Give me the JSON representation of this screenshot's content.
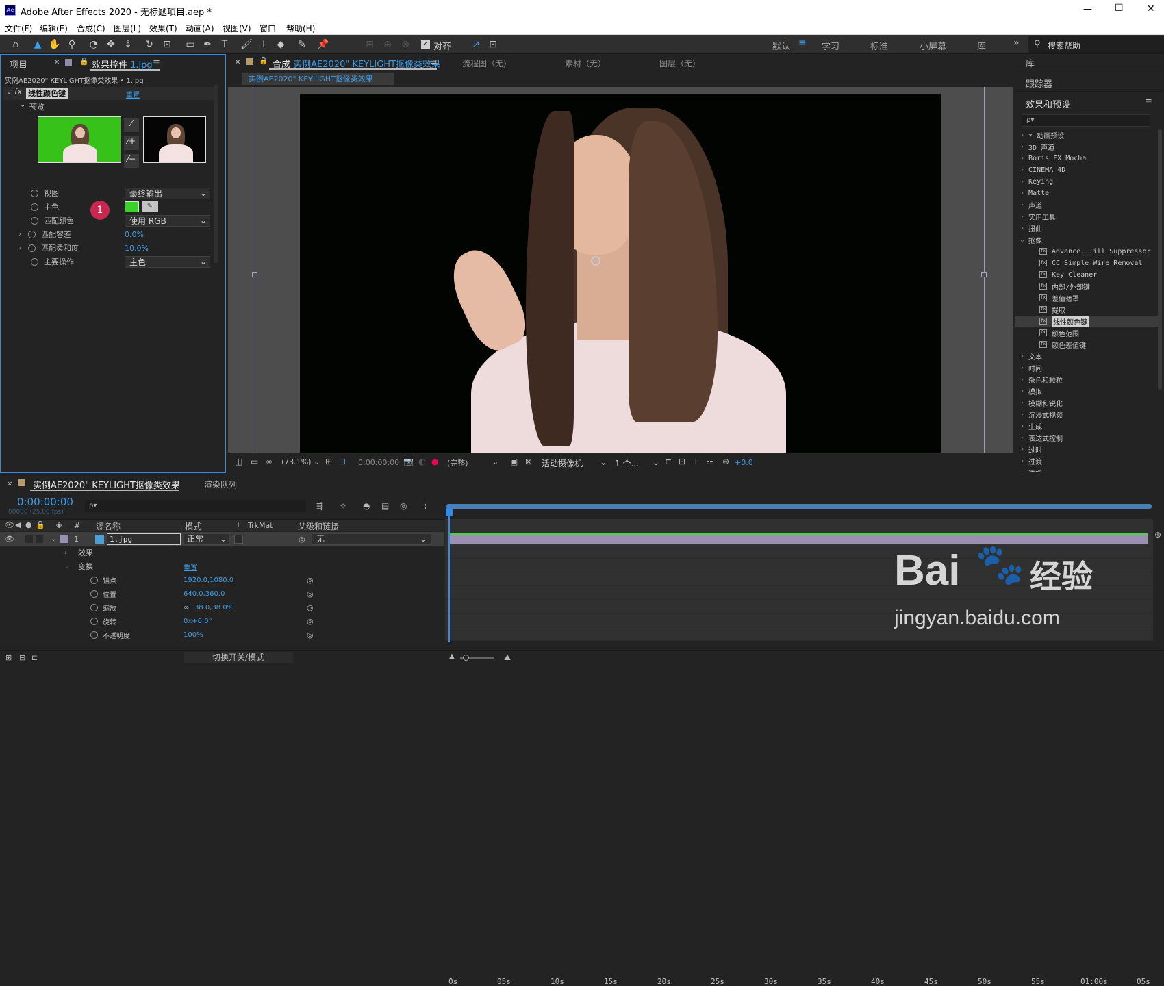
{
  "app": {
    "logo": "Ae",
    "title": "Adobe After Effects 2020 - 无标题项目.aep *"
  },
  "window_controls": {
    "minimize": "—",
    "maximize": "☐",
    "close": "✕"
  },
  "menu": [
    "文件(F)",
    "编辑(E)",
    "合成(C)",
    "图层(L)",
    "效果(T)",
    "动画(A)",
    "视图(V)",
    "窗口",
    "帮助(H)"
  ],
  "toolbar": {
    "align_label": "对齐",
    "workspaces": [
      "默认",
      "学习",
      "标准",
      "小屏幕",
      "库"
    ],
    "more": "»",
    "search_placeholder": "搜索帮助"
  },
  "left_panel": {
    "tabs": {
      "project": "项目",
      "effects_controls": "效果控件",
      "effects_file": "1.jpg"
    },
    "breadcrumb": "实例AE2020\" KEYLIGHT抠像类效果 • 1.jpg",
    "effect_name": "线性颜色键",
    "reset": "重置",
    "preview_label": "预览",
    "params": [
      {
        "label": "视图",
        "value": "最终输出",
        "type": "dropdown"
      },
      {
        "label": "主色",
        "value": "",
        "type": "color"
      },
      {
        "label": "匹配颜色",
        "value": "使用 RGB",
        "type": "dropdown"
      },
      {
        "label": "匹配容差",
        "value": "0.0%",
        "type": "value"
      },
      {
        "label": "匹配柔和度",
        "value": "10.0%",
        "type": "value"
      },
      {
        "label": "主要操作",
        "value": "主色",
        "type": "dropdown"
      }
    ],
    "badge": "1"
  },
  "comp_panel": {
    "tabs": {
      "comp_prefix": "合成",
      "comp_name": "实例AE2020\" KEYLIGHT抠像类效果",
      "flow": "流程图（无）",
      "footage": "素材（无）",
      "layer": "图层（无）"
    },
    "subtab": "实例AE2020\" KEYLIGHT抠像类效果",
    "footer": {
      "zoom": "(73.1%)",
      "time": "0:00:00:00",
      "quality": "(完整)",
      "camera": "活动摄像机",
      "views": "1 个...",
      "exposure": "+0.0"
    }
  },
  "right_panel": {
    "library": "库",
    "tracker": "跟踪器",
    "effects_presets": "效果和预设",
    "search_placeholder": "ρ▾",
    "categories_top": [
      "* 动画预设",
      "3D 声道",
      "Boris FX Mocha",
      "CINEMA 4D",
      "Keying",
      "Matte",
      "声道",
      "实用工具",
      "扭曲"
    ],
    "expanded_category": "抠像",
    "keying_effects": [
      "Advance...ill Suppressor",
      "CC Simple Wire Removal",
      "Key Cleaner",
      "内部/外部键",
      "差值遮罩",
      "提取",
      "线性颜色键",
      "颜色范围",
      "颜色差值键"
    ],
    "categories_bottom": [
      "文本",
      "时间",
      "杂色和颗粒",
      "模拟",
      "模糊和锐化",
      "沉浸式视频",
      "生成",
      "表达式控制",
      "过时",
      "过渡",
      "透视"
    ]
  },
  "timeline": {
    "tab": "实例AE2020\" KEYLIGHT抠像类效果",
    "render_queue": "渲染队列",
    "timecode": "0:00:00:00",
    "frames": "00000 (25.00 fps)",
    "search_placeholder": "ρ▾",
    "headers": {
      "num": "#",
      "source": "源名称",
      "mode": "模式",
      "t": "T",
      "trkmat": "TrkMat",
      "parent": "父级和链接"
    },
    "layer": {
      "num": "1",
      "name": "1.jpg",
      "mode": "正常",
      "parent": "无"
    },
    "effects_label": "效果",
    "transform_label": "变换",
    "reset": "重置",
    "properties": [
      {
        "label": "锚点",
        "value": "1920.0,1080.0"
      },
      {
        "label": "位置",
        "value": "640.0,360.0"
      },
      {
        "label": "缩放",
        "value": "38.0,38.0%"
      },
      {
        "label": "旋转",
        "value": "0x+0.0°"
      },
      {
        "label": "不透明度",
        "value": "100%"
      }
    ],
    "ticks": [
      "0s",
      "05s",
      "10s",
      "15s",
      "20s",
      "25s",
      "30s",
      "35s",
      "40s",
      "45s",
      "50s",
      "55s",
      "01:00s",
      "05s"
    ],
    "footer": "切换开关/模式"
  },
  "watermark": {
    "brand": "Bai",
    "brand2": "经验",
    "url": "jingyan.baidu.com"
  },
  "colors": {
    "accent": "#3c9ce8",
    "key_green": "#3bd12a",
    "panel": "#232323",
    "work_area": "#9a8fb0"
  }
}
